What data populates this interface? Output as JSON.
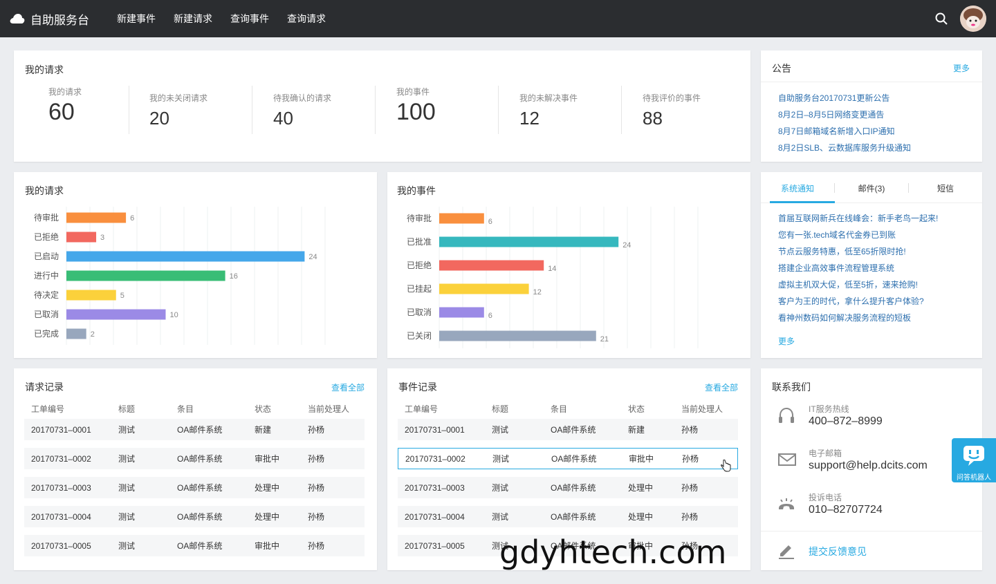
{
  "app": {
    "brand": "自助服务台",
    "nav": [
      "新建事件",
      "新建请求",
      "查询事件",
      "查询请求"
    ]
  },
  "stats_card": {
    "title": "我的请求",
    "stats": [
      {
        "label": "我的请求",
        "value": "60"
      },
      {
        "label": "我的未关闭请求",
        "value": "20"
      },
      {
        "label": "待我确认的请求",
        "value": "40"
      },
      {
        "label": "我的事件",
        "value": "100"
      },
      {
        "label": "我的未解决事件",
        "value": "12"
      },
      {
        "label": "待我评价的事件",
        "value": "88"
      }
    ]
  },
  "announcements": {
    "title": "公告",
    "more": "更多",
    "items": [
      "自助服务台20170731更新公告",
      "8月2日–8月5日网络变更通告",
      "8月7日邮箱域名新增入口IP通知",
      "8月2日SLB、云数据库服务升级通知"
    ]
  },
  "notify": {
    "tabs": [
      "系统通知",
      "邮件(3)",
      "短信"
    ],
    "items": [
      "首届互联网新兵在线峰会：新手老鸟一起来!",
      "您有一张.tech域名代金券已到账",
      "节点云服务特惠，低至65折限时抢!",
      "搭建企业高效事件流程管理系统",
      "虚拟主机双大促，低至5折，速来抢购!",
      "客户为王的时代，拿什么提升客户体验?",
      "看神州数码如何解决服务流程的短板"
    ],
    "more": "更多"
  },
  "req_chart_card": {
    "title": "我的请求"
  },
  "evt_chart_card": {
    "title": "我的事件"
  },
  "chart_data": [
    {
      "type": "bar",
      "orientation": "horizontal",
      "title": "我的请求",
      "categories": [
        "待审批",
        "已拒绝",
        "已启动",
        "进行中",
        "待决定",
        "已取消",
        "已完成"
      ],
      "values": [
        6,
        3,
        24,
        16,
        5,
        10,
        2
      ],
      "colors": [
        "#f98f3e",
        "#f2685f",
        "#45a7ea",
        "#39bd76",
        "#fbd13b",
        "#9b8ae6",
        "#98a7bd"
      ],
      "grid": true
    },
    {
      "type": "bar",
      "orientation": "horizontal",
      "title": "我的事件",
      "categories": [
        "待审批",
        "已批准",
        "已拒绝",
        "已挂起",
        "已取消",
        "已关闭"
      ],
      "values": [
        6,
        24,
        14,
        12,
        6,
        21
      ],
      "colors": [
        "#f98f3e",
        "#36b8be",
        "#f2685f",
        "#fbd13b",
        "#9b8ae6",
        "#98a7bd"
      ],
      "grid": true
    }
  ],
  "req_records": {
    "title": "请求记录",
    "view_all": "查看全部",
    "headers": [
      "工单编号",
      "标题",
      "条目",
      "状态",
      "当前处理人"
    ],
    "rows": [
      [
        "20170731–0001",
        "测试",
        "OA邮件系统",
        "新建",
        "孙杨"
      ],
      [
        "20170731–0002",
        "测试",
        "OA邮件系统",
        "审批中",
        "孙杨"
      ],
      [
        "20170731–0003",
        "测试",
        "OA邮件系统",
        "处理中",
        "孙杨"
      ],
      [
        "20170731–0004",
        "测试",
        "OA邮件系统",
        "处理中",
        "孙杨"
      ],
      [
        "20170731–0005",
        "测试",
        "OA邮件系统",
        "审批中",
        "孙杨"
      ]
    ]
  },
  "evt_records": {
    "title": "事件记录",
    "view_all": "查看全部",
    "headers": [
      "工单编号",
      "标题",
      "条目",
      "状态",
      "当前处理人"
    ],
    "rows": [
      [
        "20170731–0001",
        "测试",
        "OA邮件系统",
        "新建",
        "孙杨"
      ],
      [
        "20170731–0002",
        "测试",
        "OA邮件系统",
        "审批中",
        "孙杨"
      ],
      [
        "20170731–0003",
        "测试",
        "OA邮件系统",
        "处理中",
        "孙杨"
      ],
      [
        "20170731–0004",
        "测试",
        "OA邮件系统",
        "处理中",
        "孙杨"
      ],
      [
        "20170731–0005",
        "测试",
        "OA邮件系统",
        "审批中",
        "孙杨"
      ]
    ]
  },
  "contact": {
    "title": "联系我们",
    "items": [
      {
        "label": "IT服务热线",
        "value": "400–872–8999",
        "icon": "headset-icon"
      },
      {
        "label": "电子邮箱",
        "value": "support@help.dcits.com",
        "icon": "mail-icon"
      },
      {
        "label": "投诉电话",
        "value": "010–82707724",
        "icon": "phone-icon"
      }
    ],
    "feedback": "提交反馈意见"
  },
  "robot": {
    "label": "问答机器人"
  },
  "watermark": "gdyhtech.com",
  "colors": {
    "accent": "#27a9e1",
    "topbar": "#2b2d30"
  }
}
